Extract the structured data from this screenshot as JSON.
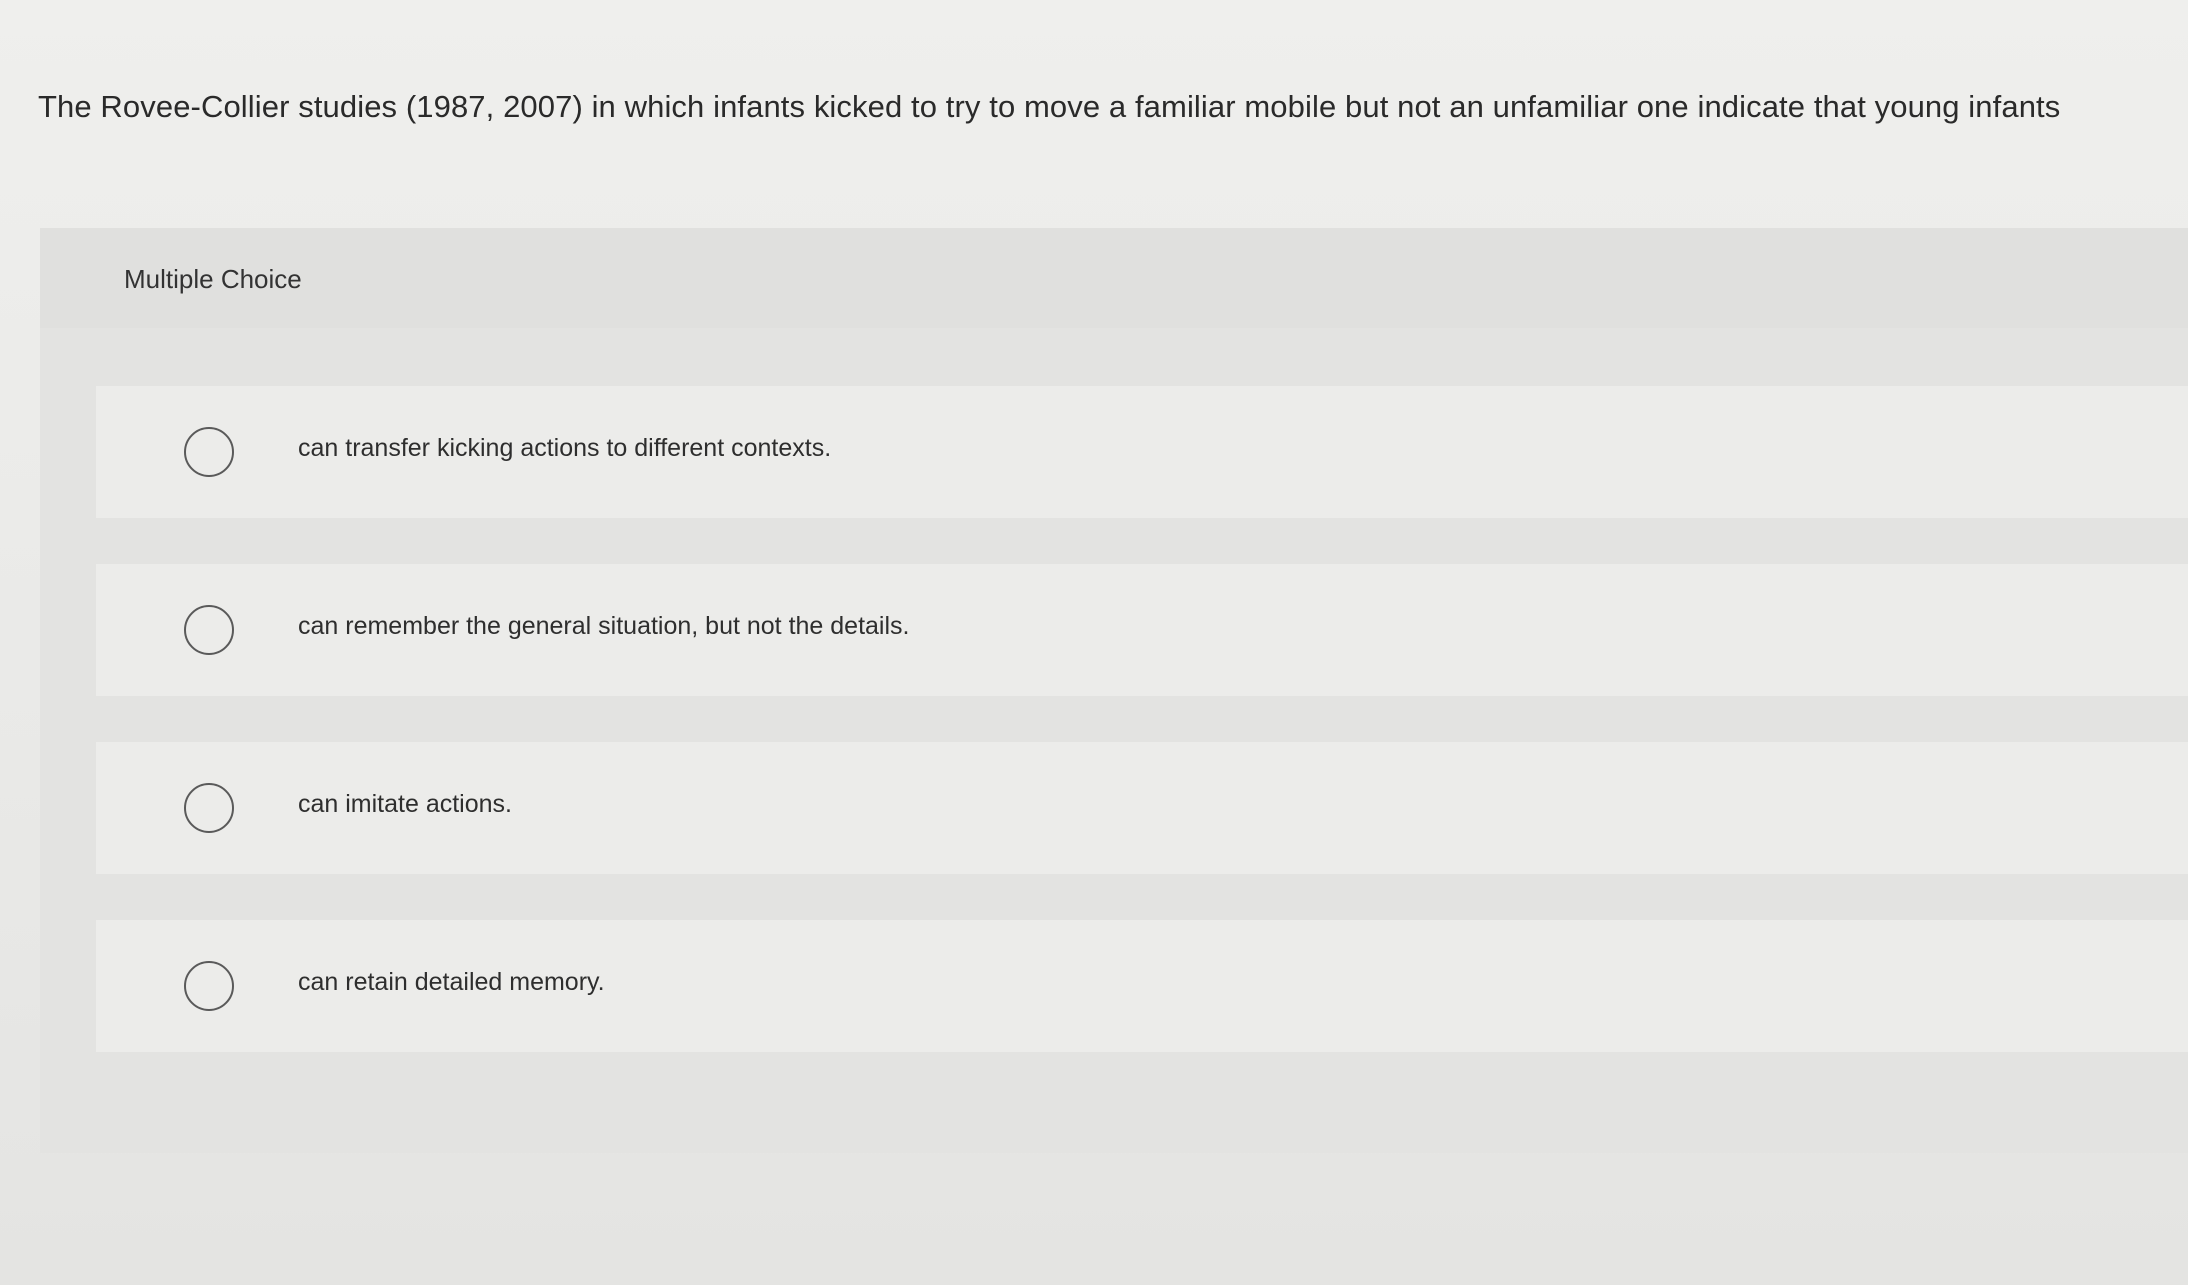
{
  "question": {
    "text": "The Rovee-Collier studies (1987, 2007) in which infants kicked to try to move a familiar mobile but not an unfamiliar one indicate that young infants"
  },
  "multiple_choice": {
    "label": "Multiple Choice",
    "options": [
      {
        "label": "can transfer kicking actions to different contexts.",
        "selected": false
      },
      {
        "label": "can remember the general situation, but not the details.",
        "selected": false
      },
      {
        "label": "can imitate actions.",
        "selected": false
      },
      {
        "label": "can retain detailed memory.",
        "selected": false
      }
    ]
  },
  "colors": {
    "background": "#ececea",
    "panel": "#e3e3e1",
    "text": "#2b2b2b",
    "radio_border": "#5a5a5a"
  }
}
